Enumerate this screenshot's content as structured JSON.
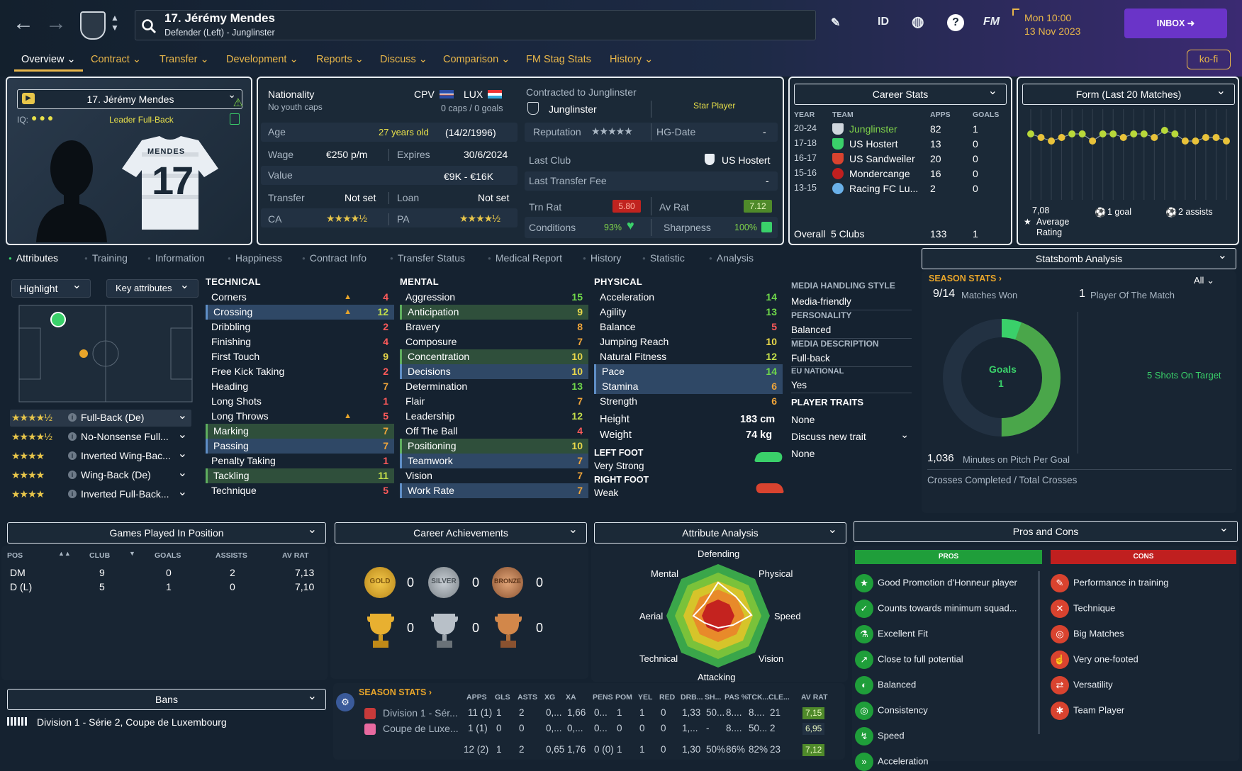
{
  "header": {
    "player_title": "17. Jérémy Mendes",
    "player_sub": "Defender (Left) - Junglinster",
    "icons": [
      "edit-icon",
      "id-icon",
      "globe-icon",
      "help-icon",
      "fm-icon"
    ],
    "id_label": "ID",
    "help_label": "?",
    "fm_label": "FM",
    "date_line1": "Mon 10:00",
    "date_line2": "13 Nov 2023",
    "inbox": "INBOX",
    "kofi": "ko-fi"
  },
  "nav": [
    "Overview",
    "Contract",
    "Transfer",
    "Development",
    "Reports",
    "Discuss",
    "Comparison",
    "FM Stag Stats",
    "History"
  ],
  "card": {
    "name": "17. Jérémy Mendes",
    "iq": "IQ:",
    "role": "Leader Full-Back",
    "shirt_name": "MENDES",
    "shirt_number": "17"
  },
  "info": {
    "nationality_label": "Nationality",
    "nationality_sub": "No youth caps",
    "nat1": "CPV",
    "nat2": "LUX",
    "caps": "0 caps / 0 goals",
    "age_label": "Age",
    "age": "27 years old",
    "dob": "(14/2/1996)",
    "wage_label": "Wage",
    "wage": "€250 p/m",
    "expires_label": "Expires",
    "expires": "30/6/2024",
    "value_label": "Value",
    "value": "€9K - €16K",
    "transfer_label": "Transfer",
    "transfer": "Not set",
    "loan_label": "Loan",
    "loan": "Not set",
    "ca_label": "CA",
    "pa_label": "PA",
    "contracted_label": "Contracted to Junglinster",
    "club": "Junglinster",
    "status": "Star Player",
    "reputation_label": "Reputation",
    "hg_label": "HG-Date",
    "hg": "-",
    "lastclub_label": "Last Club",
    "lastclub": "US Hostert",
    "fee_label": "Last Transfer Fee",
    "fee": "-",
    "trnrat_label": "Trn Rat",
    "trnrat": "5.80",
    "avrat_label": "Av Rat",
    "avrat": "7.12",
    "cond_label": "Conditions",
    "cond": "93%",
    "sharp_label": "Sharpness",
    "sharp": "100%"
  },
  "career": {
    "title": "Career Stats",
    "headers": [
      "YEAR",
      "TEAM",
      "APPS",
      "GOALS"
    ],
    "rows": [
      [
        "20-24",
        "Junglinster",
        "82",
        "1"
      ],
      [
        "17-18",
        "US Hostert",
        "13",
        "0"
      ],
      [
        "16-17",
        "US Sandweiler",
        "20",
        "0"
      ],
      [
        "15-16",
        "Mondercange",
        "16",
        "0"
      ],
      [
        "13-15",
        "Racing FC Lu...",
        "2",
        "0"
      ]
    ],
    "overall_label": "Overall",
    "overall_clubs": "5 Clubs",
    "overall_apps": "133",
    "overall_goals": "1"
  },
  "form": {
    "title": "Form (Last 20 Matches)",
    "avg": "7,08",
    "avg_label": "Average Rating",
    "goals": "1 goal",
    "assists": "2 assists",
    "values": [
      7.1,
      7.0,
      6.9,
      7.0,
      7.1,
      7.1,
      6.9,
      7.1,
      7.1,
      7.0,
      7.1,
      7.1,
      7.0,
      7.2,
      7.1,
      6.9,
      6.9,
      7.0,
      7.0,
      6.9
    ]
  },
  "tabs": [
    "Attributes",
    "Training",
    "Information",
    "Happiness",
    "Contract Info",
    "Transfer Status",
    "Medical Report",
    "History",
    "Statistic",
    "Analysis"
  ],
  "attr_controls": {
    "highlight": "Highlight",
    "key": "Key attributes"
  },
  "roles": [
    {
      "name": "Full-Back (De)",
      "stars": "★★★★½"
    },
    {
      "name": "No-Nonsense Full...",
      "stars": "★★★★½"
    },
    {
      "name": "Inverted Wing-Bac...",
      "stars": "★★★★"
    },
    {
      "name": "Wing-Back (De)",
      "stars": "★★★★"
    },
    {
      "name": "Inverted Full-Back...",
      "stars": "★★★★"
    }
  ],
  "technical": {
    "title": "TECHNICAL",
    "items": [
      [
        "Corners",
        "4"
      ],
      [
        "Crossing",
        "12"
      ],
      [
        "Dribbling",
        "2"
      ],
      [
        "Finishing",
        "4"
      ],
      [
        "First Touch",
        "9"
      ],
      [
        "Free Kick Taking",
        "2"
      ],
      [
        "Heading",
        "7"
      ],
      [
        "Long Shots",
        "1"
      ],
      [
        "Long Throws",
        "5"
      ],
      [
        "Marking",
        "7"
      ],
      [
        "Passing",
        "7"
      ],
      [
        "Penalty Taking",
        "1"
      ],
      [
        "Tackling",
        "11"
      ],
      [
        "Technique",
        "5"
      ]
    ]
  },
  "mental": {
    "title": "MENTAL",
    "items": [
      [
        "Aggression",
        "15"
      ],
      [
        "Anticipation",
        "9"
      ],
      [
        "Bravery",
        "8"
      ],
      [
        "Composure",
        "7"
      ],
      [
        "Concentration",
        "10"
      ],
      [
        "Decisions",
        "10"
      ],
      [
        "Determination",
        "13"
      ],
      [
        "Flair",
        "7"
      ],
      [
        "Leadership",
        "12"
      ],
      [
        "Off The Ball",
        "4"
      ],
      [
        "Positioning",
        "10"
      ],
      [
        "Teamwork",
        "7"
      ],
      [
        "Vision",
        "7"
      ],
      [
        "Work Rate",
        "7"
      ]
    ]
  },
  "physical": {
    "title": "PHYSICAL",
    "items": [
      [
        "Acceleration",
        "14"
      ],
      [
        "Agility",
        "13"
      ],
      [
        "Balance",
        "5"
      ],
      [
        "Jumping Reach",
        "10"
      ],
      [
        "Natural Fitness",
        "12"
      ],
      [
        "Pace",
        "14"
      ],
      [
        "Stamina",
        "6"
      ],
      [
        "Strength",
        "6"
      ]
    ],
    "height_label": "Height",
    "height": "183 cm",
    "weight_label": "Weight",
    "weight": "74 kg",
    "lf_label": "LEFT FOOT",
    "lf": "Very Strong",
    "rf_label": "RIGHT FOOT",
    "rf": "Weak"
  },
  "media": {
    "style_label": "MEDIA HANDLING STYLE",
    "style": "Media-friendly",
    "pers_label": "PERSONALITY",
    "pers": "Balanced",
    "desc_label": "MEDIA DESCRIPTION",
    "desc": "Full-back",
    "eu_label": "EU NATIONAL",
    "eu": "Yes",
    "traits_label": "PLAYER TRAITS",
    "traits": "None",
    "discuss": "Discuss new trait",
    "traits2": "None"
  },
  "statsbomb": {
    "title": "Statsbomb Analysis",
    "season": "SEASON STATS",
    "filter": "All",
    "won": "9/14",
    "won_label": "Matches Won",
    "potm": "1",
    "potm_label": "Player Of The Match",
    "goals_label": "Goals",
    "goals": "1",
    "shots": "5 Shots On Target",
    "mins": "1,036",
    "mins_label": "Minutes on Pitch Per Goal",
    "crosses": "Crosses Completed / Total Crosses"
  },
  "positions": {
    "title": "Games Played In Position",
    "headers": [
      "POS",
      "CLUB",
      "GOALS",
      "ASSISTS",
      "AV RAT"
    ],
    "rows": [
      [
        "DM",
        "9",
        "0",
        "2",
        "7,13"
      ],
      [
        "D (L)",
        "5",
        "1",
        "0",
        "7,10"
      ]
    ]
  },
  "achievements": {
    "title": "Career Achievements",
    "gold": "GOLD",
    "silver": "SILVER",
    "bronze": "BRONZE",
    "counts": [
      "0",
      "0",
      "0",
      "0",
      "0",
      "0"
    ]
  },
  "analysis": {
    "title": "Attribute Analysis",
    "labels": [
      "Defending",
      "Physical",
      "Speed",
      "Vision",
      "Attacking",
      "Technical",
      "Aerial",
      "Mental"
    ]
  },
  "proscons": {
    "title": "Pros and Cons",
    "pros_label": "PROS",
    "cons_label": "CONS",
    "pros": [
      "Good Promotion d'Honneur player",
      "Counts towards minimum squad...",
      "Excellent Fit",
      "Close to full potential",
      "Balanced",
      "Consistency",
      "Speed",
      "Acceleration"
    ],
    "cons": [
      "Performance in training",
      "Technique",
      "Big Matches",
      "Very one-footed",
      "Versatility",
      "Team Player"
    ]
  },
  "bans": {
    "title": "Bans",
    "text": "Division 1 - Série 2, Coupe de Luxembourg"
  },
  "season_stats": {
    "title": "SEASON STATS",
    "headers": [
      "APPS",
      "GLS",
      "ASTS",
      "XG",
      "XA",
      "PENS",
      "POM",
      "YEL",
      "RED",
      "DRB...",
      "SH...",
      "PAS %",
      "TCK...",
      "CLE...",
      "AV RAT"
    ],
    "rows": [
      [
        "Division 1 - Sér...",
        "11 (1)",
        "1",
        "2",
        "0,...",
        "1,66",
        "0...",
        "1",
        "1",
        "0",
        "1,33",
        "50...",
        "8....",
        "8....",
        "21",
        "7,15"
      ],
      [
        "Coupe de Luxe...",
        "1 (1)",
        "0",
        "0",
        "0,...",
        "0,...",
        "0...",
        "0",
        "0",
        "0",
        "1,...",
        "-",
        "8....",
        "50...",
        "2",
        "6,95"
      ]
    ],
    "total": [
      "12 (2)",
      "1",
      "2",
      "0,65",
      "1,76",
      "0 (0)",
      "1",
      "1",
      "0",
      "1,30",
      "50%",
      "86%",
      "82%",
      "23",
      "7,12"
    ]
  }
}
